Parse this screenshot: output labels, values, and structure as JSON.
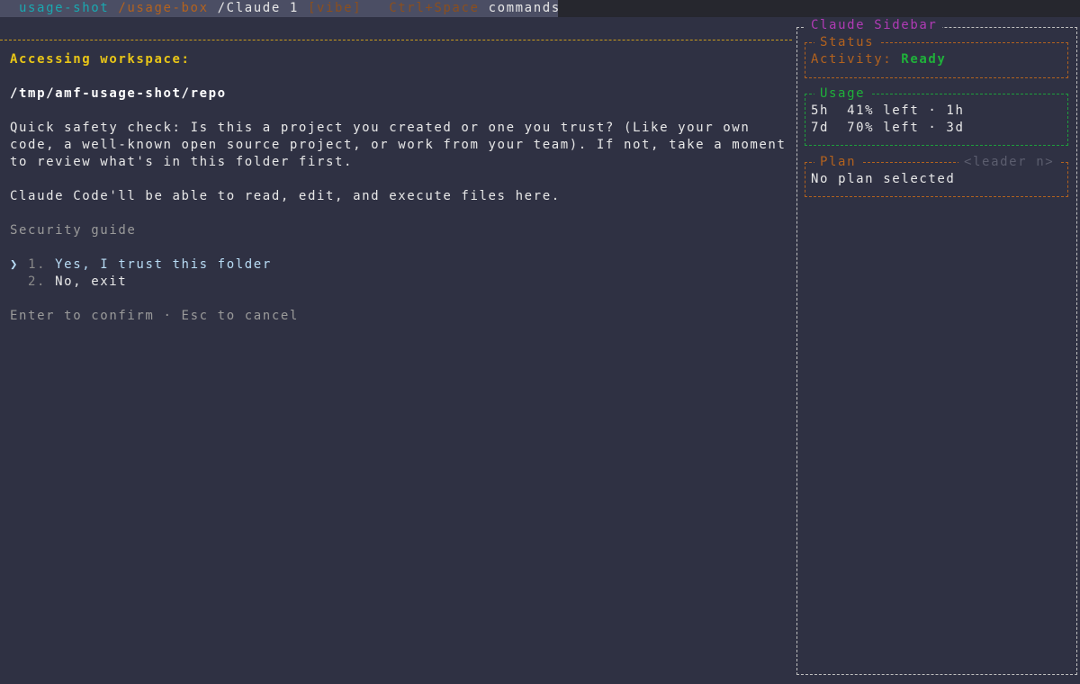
{
  "tabbar": {
    "session": "usage-shot",
    "path": "/usage-box",
    "window": "/Claude 1",
    "mode": "[vibe]",
    "shortcut": "Ctrl+Space",
    "shortcut_label": "commands"
  },
  "main": {
    "heading": "Accessing workspace:",
    "path": "/tmp/amf-usage-shot/repo",
    "paragraph_lines": [
      "Quick safety check: Is this a project you created or one you trust? (Like your own",
      "code, a well-known open source project, or work from your team). If not, take a moment",
      "to review what's in this folder first."
    ],
    "capability": "Claude Code'll be able to read, edit, and execute files here.",
    "guide": "Security guide",
    "cursor": "❯",
    "options": [
      {
        "number": "1.",
        "label": "Yes, I trust this folder"
      },
      {
        "number": "2.",
        "label": "No, exit"
      }
    ],
    "hint": "Enter to confirm · Esc to cancel"
  },
  "sidebar": {
    "title": "Claude Sidebar",
    "status": {
      "title": "Status",
      "activity_label": "Activity:",
      "activity_value": "Ready"
    },
    "usage": {
      "title": "Usage",
      "rows": [
        "5h  41% left · 1h",
        "7d  70% left · 3d"
      ]
    },
    "plan": {
      "title": "Plan",
      "shortcut": "<leader n>",
      "value": "No plan selected"
    }
  },
  "colors": {
    "background": "#2f3143",
    "accent_yellow": "#e9c617",
    "accent_orange": "#b3621e",
    "accent_green": "#1fb13a",
    "accent_purple": "#b03bb5",
    "accent_teal": "#1aa8b0"
  }
}
